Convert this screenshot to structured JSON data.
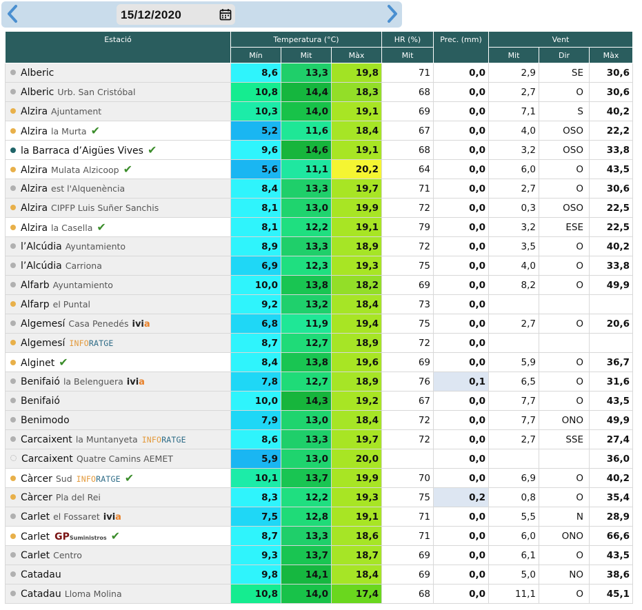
{
  "date_bar": {
    "date": "15/12/2020",
    "prev_icon": "chevron-left-icon",
    "next_icon": "chevron-right-icon",
    "calendar_icon": "calendar-icon"
  },
  "colors": {
    "header_bg": "#2a5d5e",
    "date_bar_bg": "#c9dceb",
    "arrow": "#4a8fd0",
    "dot_yellow": "#e8b04a",
    "dot_grey": "#b0b0b0",
    "dot_teal": "#1f6468",
    "check": "#3a8c2a",
    "precip_highlight": "#dde6f2"
  },
  "table": {
    "headers": {
      "station": "Estació",
      "temperature": "Temperatura (°C)",
      "hr": "HR (%)",
      "prec": "Prec. (mm)",
      "wind": "Vent",
      "t_min": "Mín",
      "t_mit": "Mit",
      "t_max": "Màx",
      "hr_mit": "Mit",
      "w_mit": "Mit",
      "w_dir": "Dir",
      "w_max": "Màx"
    },
    "rows": [
      {
        "name": "Alberic",
        "sub": "",
        "dot": "grey",
        "style": "grey",
        "badge": "",
        "check": false,
        "tmin": "8,6",
        "tmit": "13,3",
        "tmax": "19,8",
        "hr": "71",
        "prec": "0,0",
        "wmit": "2,9",
        "wdir": "SE",
        "wmax": "30,6",
        "c_min": "#2ff4fc",
        "c_mit": "#1fcf6a",
        "c_max": "#a2e324"
      },
      {
        "name": "Alberic",
        "sub": "Urb. San Cristóbal",
        "dot": "grey",
        "style": "grey",
        "badge": "",
        "check": false,
        "tmin": "10,8",
        "tmit": "14,4",
        "tmax": "18,3",
        "hr": "68",
        "prec": "0,0",
        "wmit": "2,7",
        "wdir": "O",
        "wmax": "30,6",
        "c_min": "#15ec90",
        "c_mit": "#15b63e",
        "c_max": "#93de28"
      },
      {
        "name": "Alzira",
        "sub": "Ajuntament",
        "dot": "yellow",
        "style": "grey",
        "badge": "",
        "check": false,
        "tmin": "10,3",
        "tmit": "14,0",
        "tmax": "19,1",
        "hr": "69",
        "prec": "0,0",
        "wmit": "7,1",
        "wdir": "S",
        "wmax": "40,2",
        "c_min": "#1ceca8",
        "c_mit": "#18c249",
        "c_max": "#a8e524"
      },
      {
        "name": "Alzira",
        "sub": "la Murta",
        "dot": "yellow",
        "style": "white",
        "badge": "",
        "check": true,
        "tmin": "5,2",
        "tmit": "11,6",
        "tmax": "18,4",
        "hr": "67",
        "prec": "0,0",
        "wmit": "4,0",
        "wdir": "OSO",
        "wmax": "22,2",
        "c_min": "#1ab6f2",
        "c_mit": "#1fe796",
        "c_max": "#a6e526"
      },
      {
        "name": "la Barraca d’Aigües Vives",
        "sub": "",
        "dot": "teal",
        "style": "white",
        "badge": "",
        "check": true,
        "tmin": "9,6",
        "tmit": "14,6",
        "tmax": "19,1",
        "hr": "68",
        "prec": "0,0",
        "wmit": "3,2",
        "wdir": "OSO",
        "wmax": "33,8",
        "c_min": "#2ff4fc",
        "c_mit": "#17b53c",
        "c_max": "#a8e524"
      },
      {
        "name": "Alzira",
        "sub": "Mulata Alzicoop",
        "dot": "yellow",
        "style": "white",
        "badge": "",
        "check": true,
        "tmin": "5,6",
        "tmit": "11,1",
        "tmax": "20,2",
        "hr": "64",
        "prec": "0,0",
        "wmit": "6,0",
        "wdir": "O",
        "wmax": "43,5",
        "c_min": "#1ab6f2",
        "c_mit": "#1fe7a0",
        "c_max": "#f5f532"
      },
      {
        "name": "Alzira",
        "sub": "est l'Alquenència",
        "dot": "grey",
        "style": "grey",
        "badge": "",
        "check": false,
        "tmin": "8,4",
        "tmit": "13,3",
        "tmax": "19,7",
        "hr": "71",
        "prec": "0,0",
        "wmit": "2,7",
        "wdir": "O",
        "wmax": "30,6",
        "c_min": "#2ff4fc",
        "c_mit": "#1fcf6a",
        "c_max": "#a8e524"
      },
      {
        "name": "Alzira",
        "sub": "CIPFP Luis Suñer Sanchis",
        "dot": "yellow",
        "style": "grey",
        "badge": "",
        "check": false,
        "tmin": "8,1",
        "tmit": "13,0",
        "tmax": "19,9",
        "hr": "72",
        "prec": "0,0",
        "wmit": "0,3",
        "wdir": "OSO",
        "wmax": "22,5",
        "c_min": "#2ff4fc",
        "c_mit": "#1fd46e",
        "c_max": "#a8e524"
      },
      {
        "name": "Alzira",
        "sub": "la Casella",
        "dot": "yellow",
        "style": "white",
        "badge": "",
        "check": true,
        "tmin": "8,1",
        "tmit": "12,2",
        "tmax": "19,1",
        "hr": "79",
        "prec": "0,0",
        "wmit": "3,2",
        "wdir": "ESE",
        "wmax": "22,5",
        "c_min": "#2ff4fc",
        "c_mit": "#1fdf80",
        "c_max": "#a8e524"
      },
      {
        "name": "l’Alcúdia",
        "sub": "Ayuntamiento",
        "dot": "grey",
        "style": "grey",
        "badge": "",
        "check": false,
        "tmin": "8,9",
        "tmit": "13,3",
        "tmax": "18,9",
        "hr": "72",
        "prec": "0,0",
        "wmit": "3,5",
        "wdir": "O",
        "wmax": "40,2",
        "c_min": "#2ff4fc",
        "c_mit": "#1fcf6a",
        "c_max": "#a6e526"
      },
      {
        "name": "l’Alcúdia",
        "sub": "Carriona",
        "dot": "grey",
        "style": "grey",
        "badge": "",
        "check": false,
        "tmin": "6,9",
        "tmit": "12,3",
        "tmax": "19,3",
        "hr": "75",
        "prec": "0,0",
        "wmit": "4,0",
        "wdir": "O",
        "wmax": "33,8",
        "c_min": "#1fd7f6",
        "c_mit": "#1fdf80",
        "c_max": "#a8e524"
      },
      {
        "name": "Alfarb",
        "sub": "Ayuntamiento",
        "dot": "grey",
        "style": "grey",
        "badge": "",
        "check": false,
        "tmin": "10,0",
        "tmit": "13,8",
        "tmax": "18,2",
        "hr": "69",
        "prec": "0,0",
        "wmit": "8,2",
        "wdir": "O",
        "wmax": "49,9",
        "c_min": "#2ff4fc",
        "c_mit": "#19c552",
        "c_max": "#93de28"
      },
      {
        "name": "Alfarp",
        "sub": "el Puntal",
        "dot": "yellow",
        "style": "grey",
        "badge": "",
        "check": false,
        "tmin": "9,2",
        "tmit": "13,2",
        "tmax": "18,4",
        "hr": "73",
        "prec": "0,0",
        "wmit": "",
        "wdir": "",
        "wmax": "",
        "c_min": "#2ff4fc",
        "c_mit": "#1fd06c",
        "c_max": "#a6e526"
      },
      {
        "name": "Algemesí",
        "sub": "Casa Penedés",
        "dot": "grey",
        "style": "grey",
        "badge": "ivia",
        "check": false,
        "tmin": "6,8",
        "tmit": "11,9",
        "tmax": "19,4",
        "hr": "75",
        "prec": "0,0",
        "wmit": "2,7",
        "wdir": "O",
        "wmax": "20,6",
        "c_min": "#1fd7f6",
        "c_mit": "#1fe796",
        "c_max": "#a8e524"
      },
      {
        "name": "Algemesí",
        "sub": "",
        "dot": "yellow",
        "style": "grey",
        "badge": "inforatge",
        "check": false,
        "tmin": "8,7",
        "tmit": "12,7",
        "tmax": "18,9",
        "hr": "72",
        "prec": "0,0",
        "wmit": "",
        "wdir": "",
        "wmax": "",
        "c_min": "#2ff4fc",
        "c_mit": "#1fdb78",
        "c_max": "#a6e526"
      },
      {
        "name": "Alginet",
        "sub": "",
        "dot": "yellow",
        "style": "white",
        "badge": "",
        "check": true,
        "tmin": "8,4",
        "tmit": "13,8",
        "tmax": "19,6",
        "hr": "69",
        "prec": "0,0",
        "wmit": "5,9",
        "wdir": "O",
        "wmax": "36,7",
        "c_min": "#2ff4fc",
        "c_mit": "#19c552",
        "c_max": "#a8e524"
      },
      {
        "name": "Benifaió",
        "sub": "la Belenguera",
        "dot": "grey",
        "style": "grey",
        "badge": "ivia",
        "check": false,
        "tmin": "7,8",
        "tmit": "12,7",
        "tmax": "18,9",
        "hr": "76",
        "prec": "0,1",
        "wmit": "6,5",
        "wdir": "O",
        "wmax": "31,6",
        "c_min": "#1fd7f6",
        "c_mit": "#1fdb78",
        "c_max": "#a6e526"
      },
      {
        "name": "Benifaió",
        "sub": "",
        "dot": "grey",
        "style": "grey",
        "badge": "",
        "check": false,
        "tmin": "10,0",
        "tmit": "14,3",
        "tmax": "19,2",
        "hr": "67",
        "prec": "0,0",
        "wmit": "7,7",
        "wdir": "O",
        "wmax": "43,5",
        "c_min": "#2ff4fc",
        "c_mit": "#17b53c",
        "c_max": "#a8e524"
      },
      {
        "name": "Benimodo",
        "sub": "",
        "dot": "grey",
        "style": "grey",
        "badge": "",
        "check": false,
        "tmin": "7,9",
        "tmit": "13,0",
        "tmax": "18,4",
        "hr": "72",
        "prec": "0,0",
        "wmit": "7,7",
        "wdir": "ONO",
        "wmax": "49,9",
        "c_min": "#1fd7f6",
        "c_mit": "#1fd46e",
        "c_max": "#a6e526"
      },
      {
        "name": "Carcaixent",
        "sub": "la Muntanyeta",
        "dot": "grey",
        "style": "grey",
        "badge": "inforatge",
        "check": false,
        "tmin": "8,6",
        "tmit": "13,3",
        "tmax": "19,7",
        "hr": "72",
        "prec": "0,0",
        "wmit": "2,7",
        "wdir": "SSE",
        "wmax": "27,4",
        "c_min": "#2ff4fc",
        "c_mit": "#1fcf6a",
        "c_max": "#a8e524"
      },
      {
        "name": "Carcaixent",
        "sub": "Quatre Camins AEMET",
        "dot": "hollow",
        "style": "grey",
        "badge": "",
        "check": false,
        "tmin": "5,9",
        "tmit": "13,0",
        "tmax": "20,0",
        "hr": "",
        "prec": "0,0",
        "wmit": "",
        "wdir": "",
        "wmax": "36,0",
        "c_min": "#1ab6f2",
        "c_mit": "#1fd46e",
        "c_max": "#a8e524"
      },
      {
        "name": "Càrcer",
        "sub": "Sud",
        "dot": "yellow",
        "style": "white",
        "badge": "inforatge",
        "check": true,
        "tmin": "10,1",
        "tmit": "13,7",
        "tmax": "19,9",
        "hr": "70",
        "prec": "0,0",
        "wmit": "6,9",
        "wdir": "O",
        "wmax": "40,2",
        "c_min": "#1ceca8",
        "c_mit": "#19c552",
        "c_max": "#a8e524"
      },
      {
        "name": "Càrcer",
        "sub": "Pla del Rei",
        "dot": "yellow",
        "style": "grey",
        "badge": "",
        "check": false,
        "tmin": "8,3",
        "tmit": "12,2",
        "tmax": "19,3",
        "hr": "75",
        "prec": "0,2",
        "wmit": "0,8",
        "wdir": "O",
        "wmax": "35,4",
        "c_min": "#2ff4fc",
        "c_mit": "#1fdf80",
        "c_max": "#a8e524"
      },
      {
        "name": "Carlet",
        "sub": "el Fossaret",
        "dot": "grey",
        "style": "grey",
        "badge": "ivia",
        "check": false,
        "tmin": "7,5",
        "tmit": "12,8",
        "tmax": "19,1",
        "hr": "71",
        "prec": "0,0",
        "wmit": "5,5",
        "wdir": "N",
        "wmax": "28,9",
        "c_min": "#1fd7f6",
        "c_mit": "#1fdb78",
        "c_max": "#a8e524"
      },
      {
        "name": "Carlet",
        "sub": "",
        "dot": "yellow",
        "style": "white",
        "badge": "gp",
        "check": true,
        "tmin": "8,7",
        "tmit": "13,3",
        "tmax": "18,6",
        "hr": "71",
        "prec": "0,0",
        "wmit": "6,0",
        "wdir": "ONO",
        "wmax": "66,6",
        "c_min": "#2ff4fc",
        "c_mit": "#1fcf6a",
        "c_max": "#a6e526"
      },
      {
        "name": "Carlet",
        "sub": "Centro",
        "dot": "grey",
        "style": "grey",
        "badge": "",
        "check": false,
        "tmin": "9,3",
        "tmit": "13,7",
        "tmax": "18,7",
        "hr": "69",
        "prec": "0,0",
        "wmit": "6,1",
        "wdir": "O",
        "wmax": "43,5",
        "c_min": "#2ff4fc",
        "c_mit": "#19c552",
        "c_max": "#a6e526"
      },
      {
        "name": "Catadau",
        "sub": "",
        "dot": "grey",
        "style": "grey",
        "badge": "",
        "check": false,
        "tmin": "9,8",
        "tmit": "14,1",
        "tmax": "18,4",
        "hr": "69",
        "prec": "0,0",
        "wmit": "5,0",
        "wdir": "NO",
        "wmax": "38,6",
        "c_min": "#2ff4fc",
        "c_mit": "#16b740",
        "c_max": "#a6e526"
      },
      {
        "name": "Catadau",
        "sub": "Lloma Molina",
        "dot": "grey",
        "style": "grey",
        "badge": "",
        "check": false,
        "tmin": "10,8",
        "tmit": "14,0",
        "tmax": "17,4",
        "hr": "68",
        "prec": "0,0",
        "wmit": "11,1",
        "wdir": "O",
        "wmax": "45,1",
        "c_min": "#15ec90",
        "c_mit": "#18c249",
        "c_max": "#6ad71e"
      }
    ]
  },
  "badges": {
    "ivia": {
      "part1": "ivi",
      "part2": "a"
    },
    "inforatge": {
      "part1": "INFO",
      "part2": "RATGE"
    },
    "gp": {
      "part1": "GP",
      "part2": "Suministros"
    }
  }
}
